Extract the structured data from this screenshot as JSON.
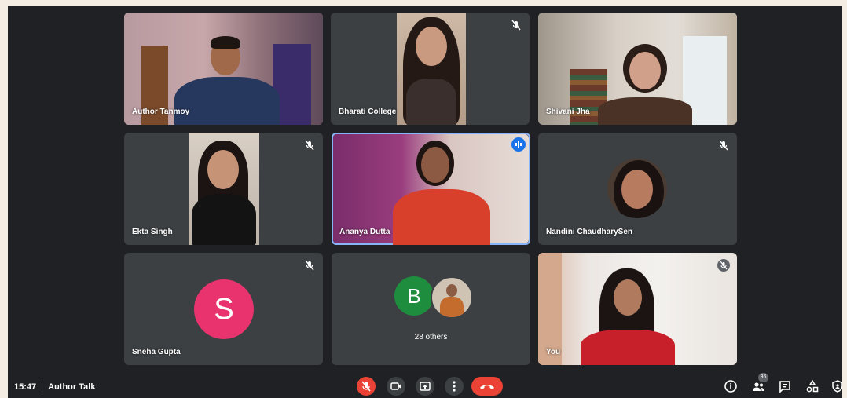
{
  "participants": [
    {
      "name": "Author Tanmoy",
      "muted": false
    },
    {
      "name": "Bharati College",
      "muted": true
    },
    {
      "name": "Shivani Jha",
      "muted": false
    },
    {
      "name": "Ekta Singh",
      "muted": true
    },
    {
      "name": "Ananya Dutta",
      "muted": false,
      "speaking": true
    },
    {
      "name": "Nandini ChaudharySen",
      "muted": true
    },
    {
      "name": "Sneha Gupta",
      "muted": true,
      "initial": "S"
    },
    {
      "name": "",
      "group": true,
      "initial": "B",
      "others_label": "28 others"
    },
    {
      "name": "You",
      "muted": true
    }
  ],
  "bottom_bar": {
    "time": "15:47",
    "meeting_title": "Author Talk",
    "people_count": "36"
  },
  "icons": [
    "mic-off-icon",
    "camera-icon",
    "present-icon",
    "more-options-icon",
    "end-call-icon",
    "info-icon",
    "people-icon",
    "chat-icon",
    "activities-icon",
    "host-controls-icon"
  ],
  "colors": {
    "accent": "#8ab4f8",
    "end_call": "#ea4335",
    "avatar_s": "#e8336e",
    "avatar_b": "#1e8e3e"
  }
}
